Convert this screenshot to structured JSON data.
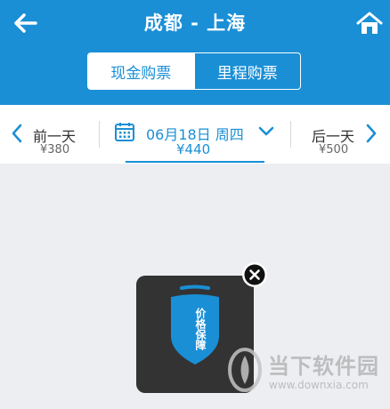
{
  "header": {
    "title": "成都 - 上海",
    "tabs": [
      {
        "label": "现金购票",
        "active": true
      },
      {
        "label": "里程购票",
        "active": false
      }
    ]
  },
  "date_bar": {
    "prev": {
      "label": "前一天",
      "price": "¥380"
    },
    "current": {
      "label": "06月18日 周四",
      "price": "¥440"
    },
    "next": {
      "label": "后一天",
      "price": "¥500"
    }
  },
  "badge": {
    "text": "价格保障"
  },
  "watermark": {
    "name": "当下软件园",
    "url": "www.downxia.com"
  },
  "colors": {
    "primary": "#1a8fd6",
    "background": "#eceef2",
    "badge_bg": "#333333"
  },
  "icons": [
    "arrow-left-icon",
    "home-icon",
    "chevron-left-icon",
    "calendar-icon",
    "chevron-down-icon",
    "chevron-right-icon",
    "close-icon",
    "shield-icon"
  ]
}
